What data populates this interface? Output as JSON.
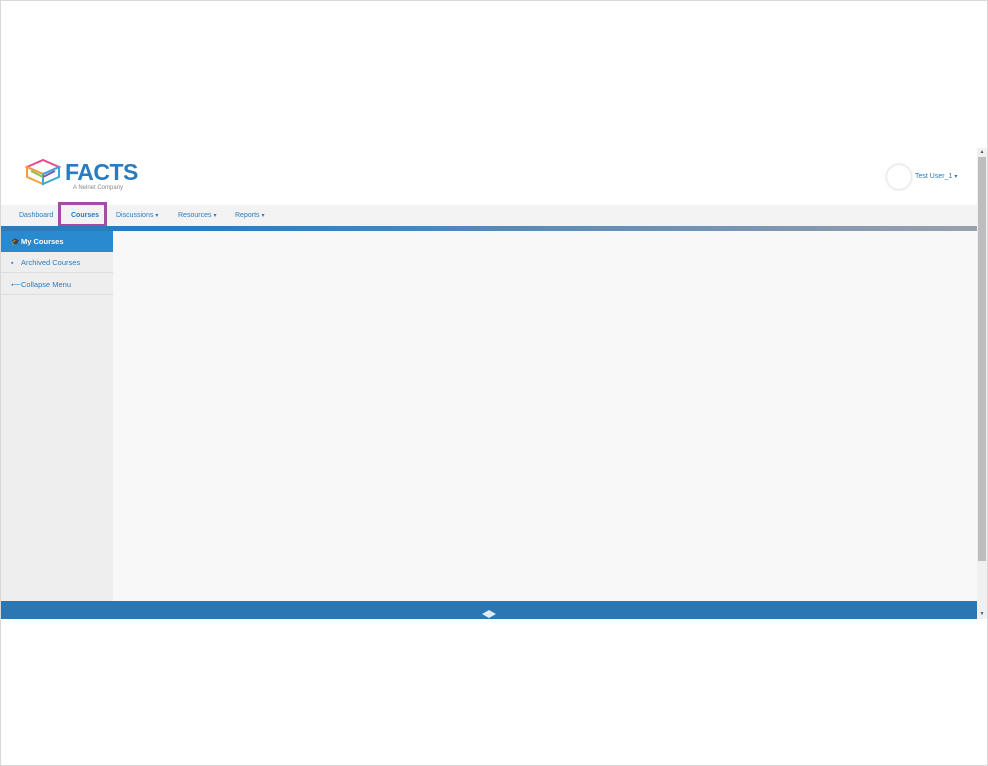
{
  "brand": {
    "name": "FACTS",
    "tagline": "A Nelnet Company",
    "primary_color": "#2a7bbf",
    "logo_icon": "facts-logo-icon"
  },
  "header": {
    "user_name": "Test User_1",
    "user_caret": "▾",
    "avatar_icon": "user-avatar"
  },
  "nav": {
    "items": [
      {
        "label": "Dashboard"
      },
      {
        "label": "Courses"
      },
      {
        "label": "Discussions",
        "caret": "▾"
      },
      {
        "label": "Resources",
        "caret": "▾"
      },
      {
        "label": "Reports",
        "caret": "▾"
      }
    ],
    "active": "Courses",
    "highlight_color": "#a64ca8"
  },
  "sidebar": {
    "items": [
      {
        "label": "My Courses",
        "icon": "graduation-cap-icon",
        "glyph": "🎓"
      },
      {
        "label": "Archived Courses",
        "icon": "archive-icon",
        "glyph": "▪"
      },
      {
        "label": "Collapse Menu",
        "icon": "arrow-left-icon",
        "glyph": "⟵"
      }
    ],
    "active_color": "#2a8ad0"
  },
  "footer": {
    "color": "#2a77b4",
    "icon": "graduation-cap-icon"
  }
}
